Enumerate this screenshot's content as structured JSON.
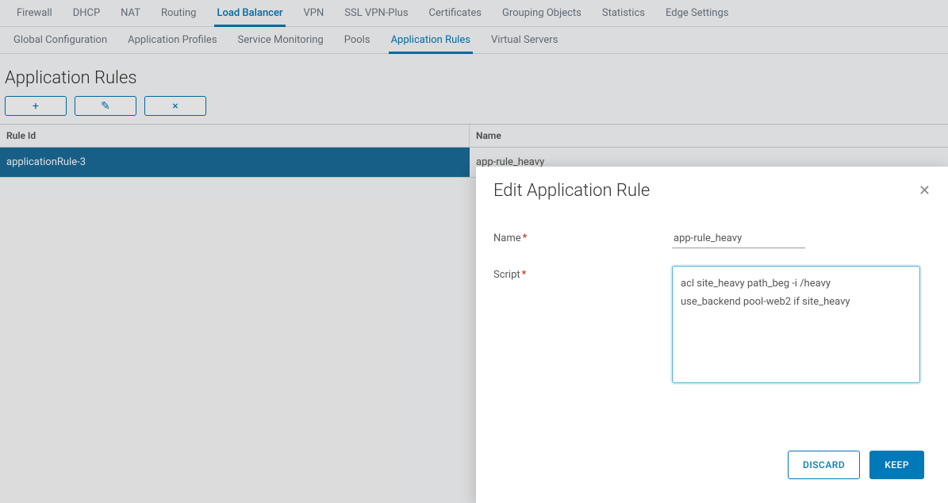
{
  "mainTabs": [
    {
      "label": "Firewall",
      "active": false
    },
    {
      "label": "DHCP",
      "active": false
    },
    {
      "label": "NAT",
      "active": false
    },
    {
      "label": "Routing",
      "active": false
    },
    {
      "label": "Load Balancer",
      "active": true
    },
    {
      "label": "VPN",
      "active": false
    },
    {
      "label": "SSL VPN-Plus",
      "active": false
    },
    {
      "label": "Certificates",
      "active": false
    },
    {
      "label": "Grouping Objects",
      "active": false
    },
    {
      "label": "Statistics",
      "active": false
    },
    {
      "label": "Edge Settings",
      "active": false
    }
  ],
  "subTabs": [
    {
      "label": "Global Configuration",
      "active": false
    },
    {
      "label": "Application Profiles",
      "active": false
    },
    {
      "label": "Service Monitoring",
      "active": false
    },
    {
      "label": "Pools",
      "active": false
    },
    {
      "label": "Application Rules",
      "active": true
    },
    {
      "label": "Virtual Servers",
      "active": false
    }
  ],
  "page": {
    "title": "Application Rules"
  },
  "toolbar": {
    "add": "+",
    "edit": "✎",
    "delete": "×"
  },
  "table": {
    "headers": {
      "ruleId": "Rule Id",
      "name": "Name"
    },
    "rows": [
      {
        "ruleId": "applicationRule-3",
        "name": "app-rule_heavy",
        "selected": true
      }
    ]
  },
  "modal": {
    "title": "Edit Application Rule",
    "labels": {
      "name": "Name",
      "script": "Script"
    },
    "values": {
      "name": "app-rule_heavy",
      "script": "acl site_heavy path_beg -i /heavy\nuse_backend pool-web2 if site_heavy"
    },
    "buttons": {
      "discard": "DISCARD",
      "keep": "KEEP"
    }
  }
}
